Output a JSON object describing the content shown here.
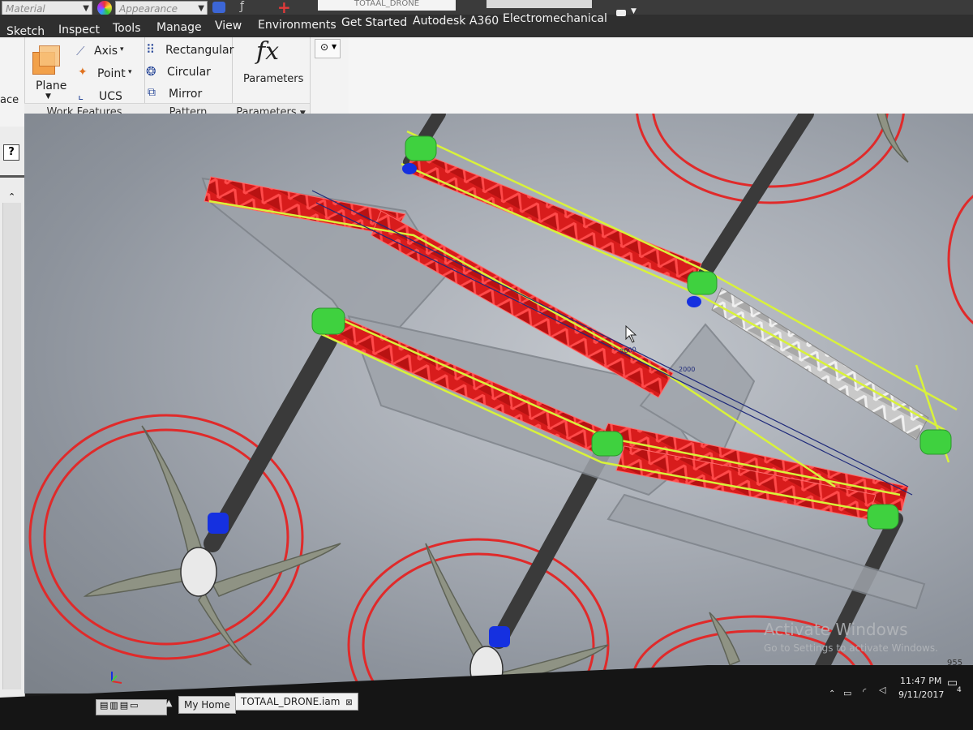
{
  "titlebar": {
    "material_combo": "Material",
    "appearance_combo": "Appearance",
    "document_title": "TOTAAL_DRONE"
  },
  "tabs": [
    "Sketch",
    "Inspect",
    "Tools",
    "Manage",
    "View",
    "Environments",
    "Get Started",
    "Autodesk A360",
    "Electromechanical"
  ],
  "ribbon": {
    "partial_left_label": "ace",
    "work_features": {
      "title": "Work Features",
      "plane": "Plane",
      "axis": "Axis",
      "point": "Point",
      "ucs": "UCS"
    },
    "pattern": {
      "title": "Pattern",
      "rectangular": "Rectangular",
      "circular": "Circular",
      "mirror": "Mirror"
    },
    "parameters": {
      "title": "Parameters",
      "button": "Parameters",
      "fx": "fx"
    }
  },
  "viewport": {
    "dimension_1": "2000",
    "dimension_2": "2000",
    "watermark_title": "Activate Windows",
    "watermark_sub": "Go to Settings to activate Windows.",
    "coord_readout": "955"
  },
  "doc_tabs": {
    "home": "My Home",
    "file": "TOTAAL_DRONE.iam"
  },
  "taskbar": {
    "time": "11:47 PM",
    "date": "9/11/2017",
    "notification_count": "4"
  },
  "colors": {
    "truss": "#e32222",
    "selection": "#d9f23a",
    "motor_green": "#3fd13f",
    "motor_blue": "#1530e0",
    "prop_circle": "#e02a2a",
    "arm": "#3a3a3a"
  }
}
